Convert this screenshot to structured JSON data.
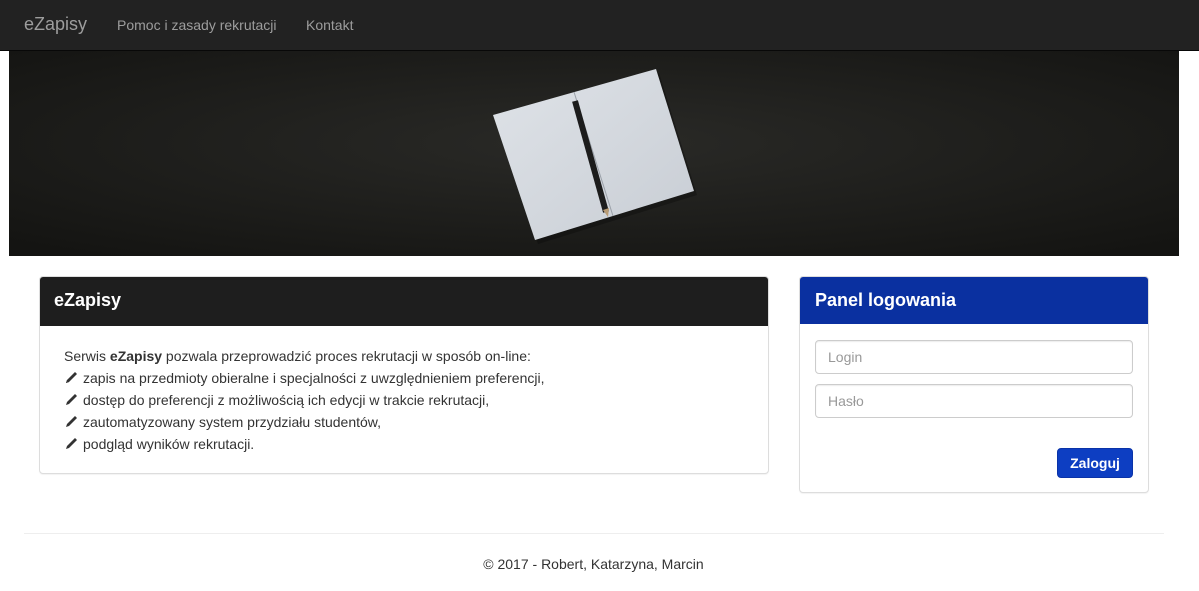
{
  "navbar": {
    "brand": "eZapisy",
    "links": [
      "Pomoc i zasady rekrutacji",
      "Kontakt"
    ]
  },
  "info_panel": {
    "title": "eZapisy",
    "intro_prefix": "Serwis ",
    "intro_bold": "eZapisy",
    "intro_suffix": " pozwala przeprowadzić proces rekrutacji w sposób on-line:",
    "features": [
      "zapis na przedmioty obieralne i specjalności z uwzględnieniem preferencji,",
      "dostęp do preferencji z możliwością ich edycji w trakcie rekrutacji,",
      "zautomatyzowany system przydziału studentów,",
      "podgląd wyników rekrutacji."
    ],
    "feature_icon": "pencil-icon"
  },
  "login_panel": {
    "title": "Panel logowania",
    "login_placeholder": "Login",
    "password_placeholder": "Hasło",
    "submit_label": "Zaloguj"
  },
  "footer": {
    "text": "© 2017 - Robert, Katarzyna, Marcin"
  },
  "colors": {
    "navbar_bg": "#222222",
    "info_header_bg": "#1e1e1e",
    "login_header_bg": "#0a30a0",
    "button_bg": "#0d3ec2"
  }
}
